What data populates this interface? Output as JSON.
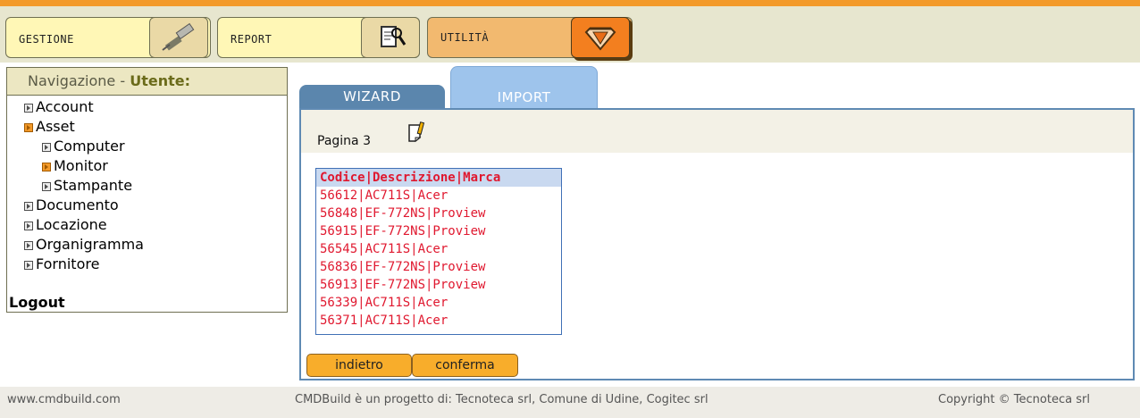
{
  "menu": {
    "gestione_label": "GESTIONE",
    "report_label": "REPORT",
    "utilita_label": "UTILITÀ"
  },
  "navigation": {
    "title_prefix": "Navigazione - ",
    "title_user": "Utente:",
    "items": [
      {
        "label": "Account"
      },
      {
        "label": "Asset"
      },
      {
        "label": "Computer"
      },
      {
        "label": "Monitor"
      },
      {
        "label": "Stampante"
      },
      {
        "label": "Documento"
      },
      {
        "label": "Locazione"
      },
      {
        "label": "Organigramma"
      },
      {
        "label": "Fornitore"
      }
    ],
    "logout_label": "Logout"
  },
  "tabs": {
    "wizard_label": "WIZARD",
    "import_label": "IMPORT"
  },
  "panel": {
    "page_label": "Pagina 3",
    "list_header": "Codice|Descrizione|Marca",
    "list_rows": [
      "56612|AC711S|Acer",
      "56848|EF-772NS|Proview",
      "56915|EF-772NS|Proview",
      "56545|AC711S|Acer",
      "56836|EF-772NS|Proview",
      "56913|EF-772NS|Proview",
      "56339|AC711S|Acer",
      "56371|AC711S|Acer"
    ],
    "back_label": "indietro",
    "confirm_label": "conferma"
  },
  "footer": {
    "left": "www.cmdbuild.com",
    "middle": "CMDBuild è un progetto di: Tecnoteca srl, Comune di Udine, Cogitec srl",
    "right": "Copyright © Tecnoteca srl"
  },
  "colors": {
    "accent_orange": "#f39a2a",
    "tab_blue": "#5b86ad",
    "list_text_red": "#e0182f"
  },
  "icons": {
    "gestione": "usb-plug-icon",
    "report": "document-magnifier-icon",
    "utilita": "toolbox-icon",
    "page": "note-pencil-icon"
  }
}
